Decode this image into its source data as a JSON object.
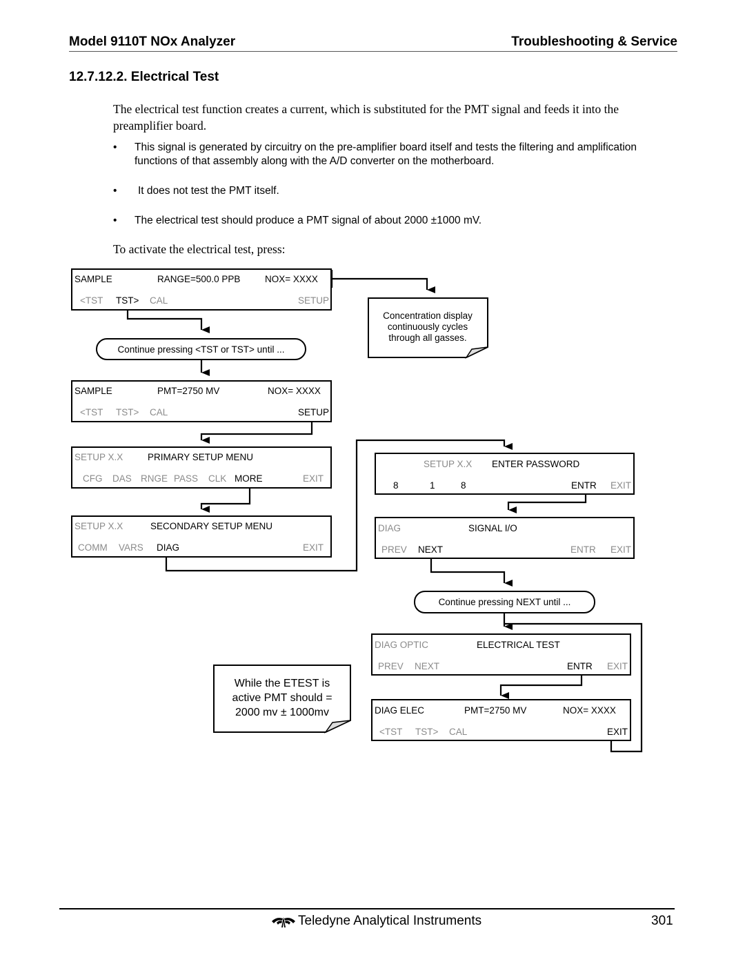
{
  "header": {
    "left_title": "Model 9110T NOx Analyzer",
    "right_title": "Troubleshooting & Service"
  },
  "section": {
    "title": "12.7.12.2. Electrical Test",
    "intro": "The electrical test function creates a current, which is substituted for the PMT signal and feeds it into the preamplifier board.",
    "bullets": [
      "This signal is generated by circuitry on the pre-amplifier board itself and tests the filtering and amplification functions of that assembly along with the A/D converter on the motherboard.",
      "It does not test the PMT itself.",
      "The electrical test should produce a PMT signal of about 2000 ±1000 mV."
    ],
    "bullet_glyph": "•",
    "instruction": "To activate the electrical test, press:"
  },
  "flowchart": {
    "screen1": {
      "row1": [
        "SAMPLE",
        "RANGE=500.0 PPB",
        "NOX= XXXX"
      ],
      "row2": [
        "<TST",
        "TST>",
        "CAL",
        "SETUP"
      ]
    },
    "pill1": {
      "prefix": "Continue pressing ",
      "key1": "<TST",
      "mid": " or ",
      "key2": "TST>",
      "suffix": " until ..."
    },
    "note1": {
      "lines": [
        "Concentration display",
        "continuously cycles",
        "through all gasses."
      ]
    },
    "screen2": {
      "row1": [
        "SAMPLE",
        "PMT=2750 MV",
        "NOX= XXXX"
      ],
      "row2": [
        "<TST",
        "TST>",
        "CAL",
        "SETUP"
      ]
    },
    "screen3": {
      "row1": [
        "SETUP X.X",
        "PRIMARY SETUP MENU"
      ],
      "row2": [
        "CFG",
        "DAS",
        "RNGE",
        "PASS",
        "CLK",
        "MORE",
        "EXIT"
      ]
    },
    "screen4": {
      "row1": [
        "SETUP X.X",
        "SECONDARY SETUP MENU"
      ],
      "row2": [
        "COMM",
        "VARS",
        "DIAG",
        "EXIT"
      ]
    },
    "screen5": {
      "row1": [
        "SETUP X.X",
        "ENTER PASSWORD"
      ],
      "row2": [
        "8",
        "1",
        "8",
        "ENTR",
        "EXIT"
      ]
    },
    "screen6": {
      "row1": [
        "DIAG",
        "SIGNAL I/O"
      ],
      "row2": [
        "PREV",
        "NEXT",
        "ENTR",
        "EXIT"
      ]
    },
    "pill2": {
      "prefix": "Continue pressing ",
      "key1": "NEXT",
      "suffix": " until ..."
    },
    "screen7": {
      "row1": [
        "DIAG OPTIC",
        "ELECTRICAL TEST"
      ],
      "row2": [
        "PREV",
        "NEXT",
        "ENTR",
        "EXIT"
      ]
    },
    "screen8": {
      "row1": [
        "DIAG ELEC",
        "PMT=2750 MV",
        "NOX= XXXX"
      ],
      "row2": [
        "<TST",
        "TST>",
        "CAL",
        "EXIT"
      ]
    },
    "note2": {
      "lines": [
        "While the ETEST is",
        "active PMT should =",
        "2000 mv ± 1000mv"
      ]
    }
  },
  "footer": {
    "brand": "Teledyne Analytical Instruments",
    "page_number": "301"
  }
}
